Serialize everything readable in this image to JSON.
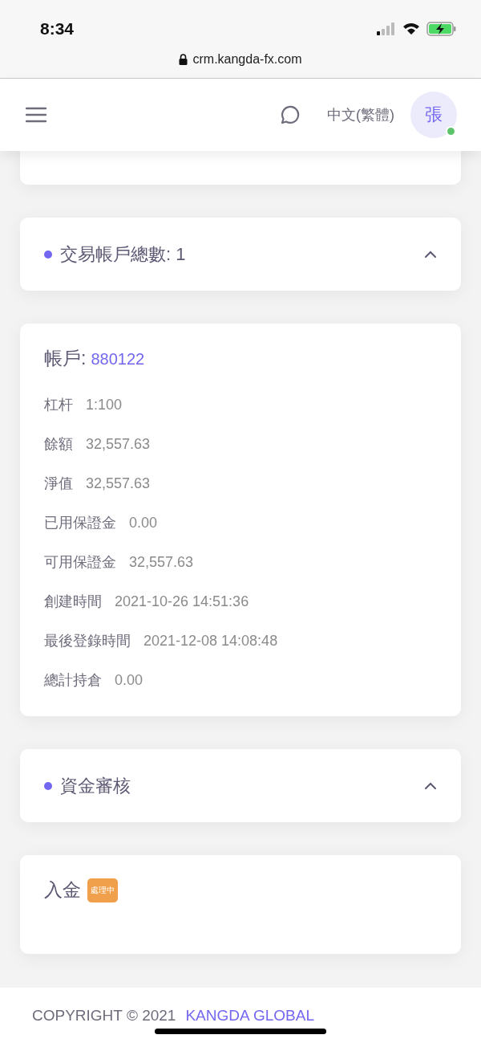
{
  "status_bar": {
    "time": "8:34"
  },
  "browser": {
    "url": "crm.kangda-fx.com"
  },
  "header": {
    "language": "中文(繁體)",
    "avatar": {
      "initial": "張",
      "online": true
    }
  },
  "sections": [
    {
      "title": "交易帳戶總數: 1",
      "expanded": true,
      "cards": [
        {
          "kind": "account",
          "label": "帳戶:",
          "number": "880122",
          "fields": [
            {
              "label": "杠杆",
              "value": "1:100"
            },
            {
              "label": "餘額",
              "value": "32,557.63"
            },
            {
              "label": "淨值",
              "value": "32,557.63"
            },
            {
              "label": "已用保證金",
              "value": "0.00"
            },
            {
              "label": "可用保證金",
              "value": "32,557.63"
            },
            {
              "label": "創建時間",
              "value": "2021-10-26 14:51:36"
            },
            {
              "label": "最後登錄時間",
              "value": "2021-12-08 14:08:48"
            },
            {
              "label": "總計持倉",
              "value": "0.00"
            }
          ]
        }
      ]
    },
    {
      "title": "資金審核",
      "expanded": true,
      "cards": [
        {
          "kind": "deposit",
          "title": "入金",
          "status": "處理中"
        }
      ]
    }
  ],
  "footer": {
    "copyright": "COPYRIGHT © 2021",
    "company": "KANGDA GLOBAL"
  }
}
